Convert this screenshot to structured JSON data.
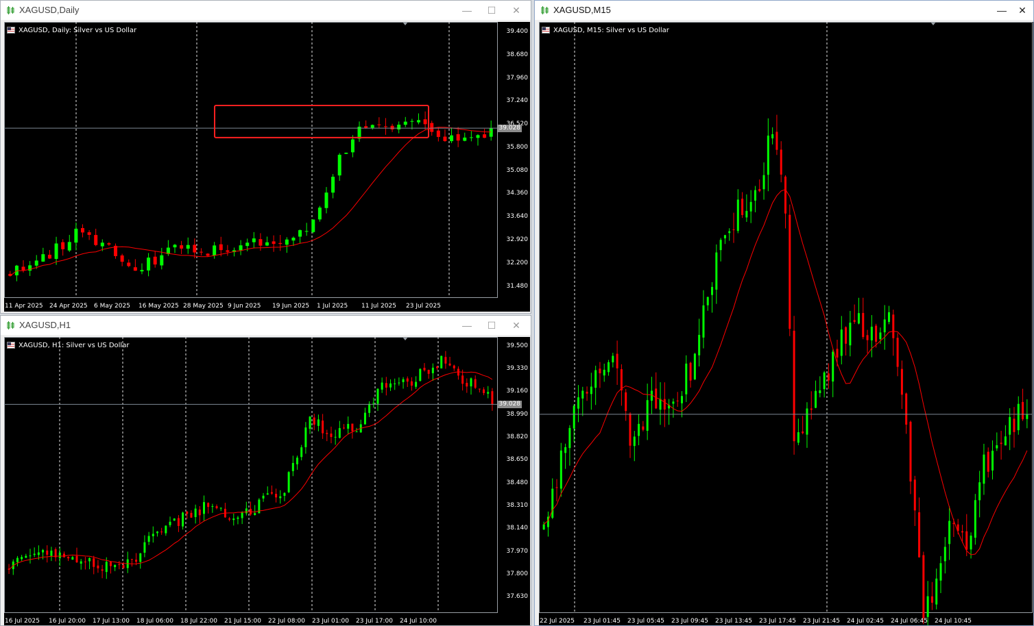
{
  "colors": {
    "bull": "#00ff00",
    "bear": "#ff0000",
    "ma": "#ff0000",
    "bid_line": "#7f8a96",
    "grid": "#ffffff",
    "highlight": "#ff2020"
  },
  "windows": [
    {
      "id": "daily",
      "title": "XAGUSD,Daily",
      "header": "XAGUSD, Daily:  Silver vs US Dollar",
      "price_labels": [
        "39.400",
        "38.680",
        "37.960",
        "37.240",
        "36.520",
        "35.800",
        "35.080",
        "34.360",
        "33.640",
        "32.920",
        "32.200",
        "31.480"
      ],
      "time_labels": [
        "11 Apr 2025",
        "24 Apr 2025",
        "6 May 2025",
        "16 May 2025",
        "28 May 2025",
        "9 Jun 2025",
        "19 Jun 2025",
        "1 Jul 2025",
        "11 Jul 2025",
        "23 Jul 2025"
      ],
      "current_price": "39.028",
      "highlight_box": {
        "price_top": 37.12,
        "price_bottom": 36.12
      },
      "chart_data": {
        "type": "candlestick",
        "price_range": [
          31.15,
          39.72
        ],
        "bars": 74,
        "anchors": [
          [
            0,
            31.9
          ],
          [
            6,
            32.5
          ],
          [
            11,
            33.3
          ],
          [
            15,
            32.6
          ],
          [
            19,
            31.9
          ],
          [
            25,
            32.8
          ],
          [
            31,
            32.6
          ],
          [
            37,
            32.9
          ],
          [
            43,
            33.0
          ],
          [
            46,
            33.6
          ],
          [
            50,
            35.5
          ],
          [
            53,
            36.3
          ],
          [
            58,
            36.4
          ],
          [
            63,
            36.7
          ],
          [
            66,
            36.0
          ],
          [
            70,
            36.0
          ],
          [
            74,
            36.3
          ],
          [
            78,
            36.7
          ],
          [
            80,
            36.4
          ],
          [
            83,
            37.3
          ],
          [
            86,
            38.4
          ],
          [
            89,
            38.1
          ],
          [
            92,
            38.6
          ],
          [
            95,
            39.0
          ]
        ],
        "seed": 11
      }
    },
    {
      "id": "h1",
      "title": "XAGUSD,H1",
      "header": "XAGUSD, H1:  Silver vs US Dollar",
      "price_labels": [
        "39.500",
        "39.330",
        "39.160",
        "38.990",
        "38.820",
        "38.650",
        "38.480",
        "38.310",
        "38.140",
        "37.970",
        "37.800",
        "37.630"
      ],
      "time_labels": [
        "16 Jul 2025",
        "16 Jul 20:00",
        "17 Jul 13:00",
        "18 Jul 06:00",
        "18 Jul 22:00",
        "21 Jul 15:00",
        "22 Jul 08:00",
        "23 Jul 01:00",
        "23 Jul 17:00",
        "24 Jul 10:00"
      ],
      "current_price": "39.028",
      "chart_data": {
        "type": "candlestick",
        "price_range": [
          37.52,
          39.57
        ],
        "bars": 115,
        "anchors": [
          [
            0,
            37.85
          ],
          [
            8,
            38.0
          ],
          [
            16,
            37.9
          ],
          [
            24,
            37.85
          ],
          [
            30,
            37.9
          ],
          [
            34,
            38.1
          ],
          [
            40,
            38.2
          ],
          [
            46,
            38.3
          ],
          [
            52,
            38.25
          ],
          [
            58,
            38.3
          ],
          [
            65,
            38.45
          ],
          [
            71,
            38.95
          ],
          [
            76,
            38.85
          ],
          [
            82,
            38.9
          ],
          [
            88,
            39.2
          ],
          [
            95,
            39.25
          ],
          [
            102,
            39.4
          ],
          [
            107,
            39.25
          ],
          [
            111,
            39.2
          ],
          [
            115,
            39.05
          ]
        ],
        "seed": 23
      }
    },
    {
      "id": "m15",
      "title": "XAGUSD,M15",
      "header": "XAGUSD, M15:  Silver vs US Dollar",
      "price_labels": [],
      "time_labels": [
        "22 Jul 2025",
        "23 Jul 01:45",
        "23 Jul 05:45",
        "23 Jul 09:45",
        "23 Jul 13:45",
        "23 Jul 17:45",
        "23 Jul 21:45",
        "24 Jul 02:45",
        "24 Jul 06:45",
        "24 Jul 10:45"
      ],
      "current_price": "",
      "chart_data": {
        "type": "candlestick",
        "price_range": [
          38.4,
          39.8
        ],
        "bars": 113,
        "anchors": [
          [
            0,
            38.6
          ],
          [
            5,
            38.8
          ],
          [
            10,
            38.95
          ],
          [
            16,
            39.0
          ],
          [
            20,
            38.8
          ],
          [
            25,
            38.9
          ],
          [
            30,
            38.9
          ],
          [
            35,
            39.0
          ],
          [
            40,
            39.25
          ],
          [
            45,
            39.35
          ],
          [
            50,
            39.4
          ],
          [
            53,
            39.55
          ],
          [
            56,
            39.35
          ],
          [
            58,
            38.8
          ],
          [
            62,
            38.9
          ],
          [
            67,
            39.0
          ],
          [
            72,
            39.1
          ],
          [
            76,
            39.05
          ],
          [
            80,
            39.1
          ],
          [
            84,
            38.85
          ],
          [
            88,
            38.4
          ],
          [
            91,
            38.45
          ],
          [
            94,
            38.6
          ],
          [
            98,
            38.55
          ],
          [
            102,
            38.75
          ],
          [
            106,
            38.8
          ],
          [
            112,
            38.9
          ]
        ],
        "seed": 37
      }
    }
  ]
}
